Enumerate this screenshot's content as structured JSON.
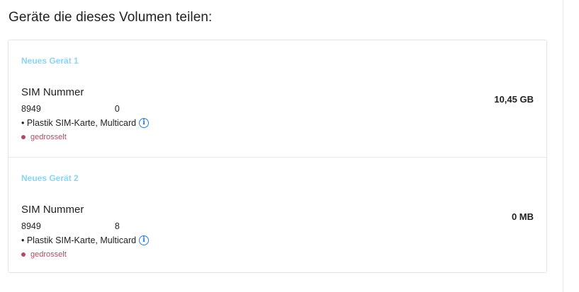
{
  "section": {
    "title": "Geräte die dieses Volumen teilen:"
  },
  "devices": [
    {
      "name": "Neues Gerät 1",
      "sim_label": "SIM Nummer",
      "sim_prefix": "8949",
      "sim_suffix": "0",
      "sim_type": "• Plastik SIM-Karte, Multicard",
      "status": "gedrosselt",
      "usage": "10,45 GB"
    },
    {
      "name": "Neues Gerät 2",
      "sim_label": "SIM Nummer",
      "sim_prefix": "8949",
      "sim_suffix": "8",
      "sim_type": "• Plastik SIM-Karte, Multicard",
      "status": "gedrosselt",
      "usage": "0 MB"
    }
  ],
  "icons": {
    "info": "i"
  },
  "colors": {
    "device_name": "#8fd3ee",
    "status_dot": "#b04a62",
    "status_text": "#a84f63",
    "info_icon": "#2a7fd0",
    "card_border": "#e3e3e3"
  }
}
